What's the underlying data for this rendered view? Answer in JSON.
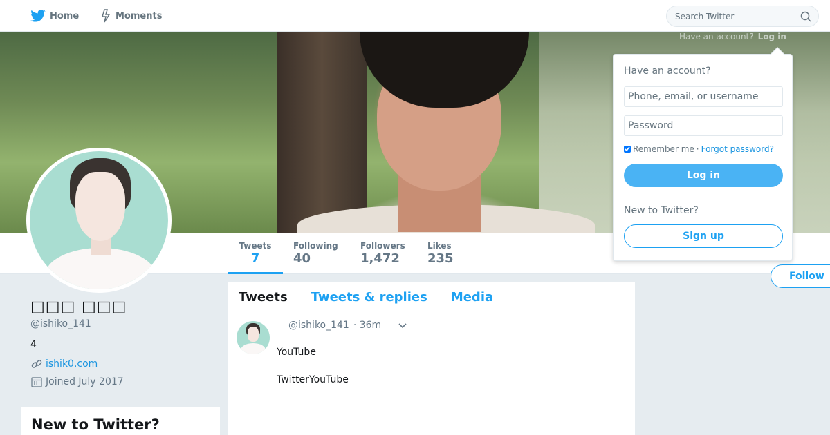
{
  "nav": {
    "home_label": "Home",
    "moments_label": "Moments",
    "search_placeholder": "Search Twitter",
    "icons": [
      "twitter-bird-icon",
      "lightning-icon",
      "search-icon"
    ],
    "brand_color": "#1da1f2"
  },
  "banner": {
    "ghost_prompt": "Have an account?",
    "ghost_login": "Log in"
  },
  "profile": {
    "display_name": "□□□ □□□",
    "handle": "@ishiko_141",
    "bio": "4",
    "website": "ishik0.com",
    "joined": "Joined July 2017",
    "follow_label": "Follow"
  },
  "stats": {
    "tweets_label": "Tweets",
    "tweets": "7",
    "following_label": "Following",
    "following": "40",
    "followers_label": "Followers",
    "followers": "1,472",
    "likes_label": "Likes",
    "likes": "235"
  },
  "timeline": {
    "tabs": [
      {
        "label": "Tweets",
        "active": true
      },
      {
        "label": "Tweets & replies",
        "active": false
      },
      {
        "label": "Media",
        "active": false
      }
    ],
    "tweet": {
      "handle": "@ishiko_141",
      "time": "· 36m",
      "line1": "YouTube",
      "line2": "TwitterYouTube"
    }
  },
  "login": {
    "heading": "Have an account?",
    "username_placeholder": "Phone, email, or username",
    "password_placeholder": "Password",
    "remember_label": "Remember me",
    "separator": "·",
    "forgot_label": "Forgot password?",
    "login_button": "Log in",
    "new_label": "New to Twitter?",
    "signup_button": "Sign up"
  },
  "sidebar_box": {
    "heading": "New to Twitter?"
  }
}
